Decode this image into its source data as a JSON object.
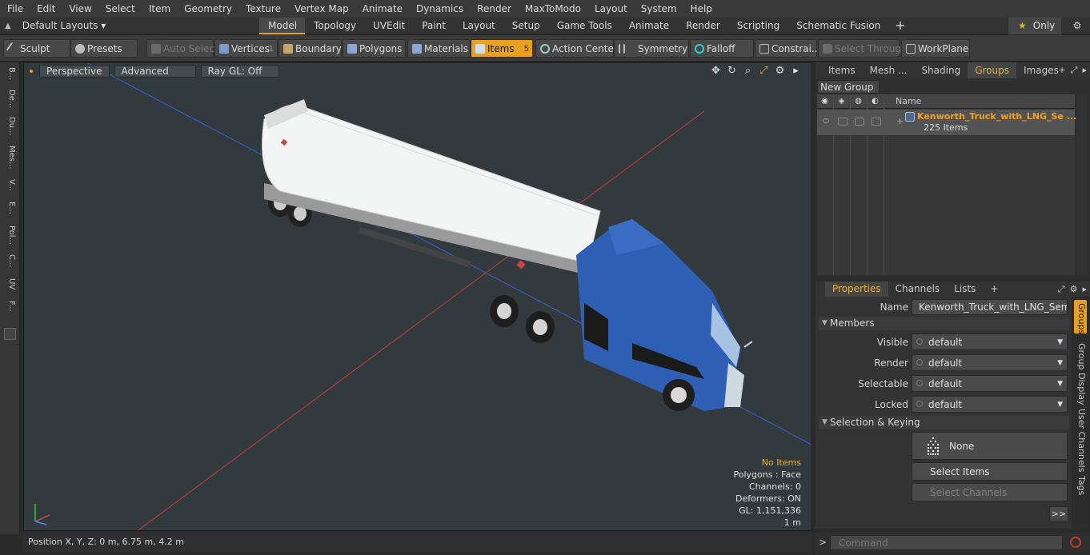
{
  "menu": [
    "File",
    "Edit",
    "View",
    "Select",
    "Item",
    "Geometry",
    "Texture",
    "Vertex Map",
    "Animate",
    "Dynamics",
    "Render",
    "MaxToModo",
    "Layout",
    "System",
    "Help"
  ],
  "layout_bar": {
    "layouts_label": "Default Layouts ▾",
    "tabs": [
      {
        "label": "Model",
        "active": true
      },
      {
        "label": "Topology"
      },
      {
        "label": "UVEdit"
      },
      {
        "label": "Paint"
      },
      {
        "label": "Layout"
      },
      {
        "label": "Setup"
      },
      {
        "label": "Game Tools"
      },
      {
        "label": "Animate"
      },
      {
        "label": "Render"
      },
      {
        "label": "Scripting"
      },
      {
        "label": "Schematic Fusion"
      }
    ],
    "add_label": "+",
    "only_label": "Only"
  },
  "toolbar": {
    "sculpt": "Sculpt",
    "presets": "Presets",
    "auto_select": "Auto Select",
    "vertices": "Vertices",
    "vertices_count": "1",
    "boundary": "Boundary",
    "polygons": "Polygons",
    "materials": "Materials",
    "items": "Items",
    "items_count": "5",
    "action_center": "Action Center",
    "symmetry": "Symmetry",
    "falloff": "Falloff",
    "constraints": "Constrai...",
    "select_through": "Select Through",
    "workplane": "WorkPlane"
  },
  "left_strip": [
    "B...",
    "De...",
    "Du...",
    "Mes...",
    "V...",
    "E...",
    "Pol...",
    "C...",
    "UV",
    "F..."
  ],
  "viewport": {
    "perspective": "Perspective",
    "advanced": "Advanced",
    "raygl": "Ray GL: Off",
    "info": {
      "no_items": "No Items",
      "polygons": "Polygons : Face",
      "channels": "Channels: 0",
      "deformers": "Deformers: ON",
      "gl": "GL: 1,151,336",
      "scale": "1 m"
    }
  },
  "status": "Position X, Y, Z:   0 m, 6.75 m, 4.2 m",
  "right_tabs": [
    "Items",
    "Mesh ...",
    "Shading",
    "Groups",
    "Images"
  ],
  "right_active": "Groups",
  "groups": {
    "new_group": "New Group",
    "name_header": "Name",
    "row_name": "Kenworth_Truck_with_LNG_Se",
    "row_more": "...",
    "row_items": "225 Items"
  },
  "prop_tabs": [
    "Properties",
    "Channels",
    "Lists"
  ],
  "properties": {
    "name_label": "Name",
    "name_value": "Kenworth_Truck_with_LNG_Semi_Trail",
    "members_section": "Members",
    "visible_label": "Visible",
    "visible_value": "default",
    "render_label": "Render",
    "render_value": "default",
    "selectable_label": "Selectable",
    "selectable_value": "default",
    "locked_label": "Locked",
    "locked_value": "default",
    "selection_section": "Selection & Keying",
    "none_label": "None",
    "select_items": "Select Items",
    "select_channels": "Select Channels",
    "more": ">>"
  },
  "vertical_tabs": [
    "Groups",
    "Group Display",
    "User Channels",
    "Tags"
  ],
  "command": {
    "prompt": ">",
    "placeholder": "Command"
  },
  "colors": {
    "accent": "#e8a020",
    "truck_blue": "#2f5fb4",
    "viewport_bg": "#333a3d"
  }
}
